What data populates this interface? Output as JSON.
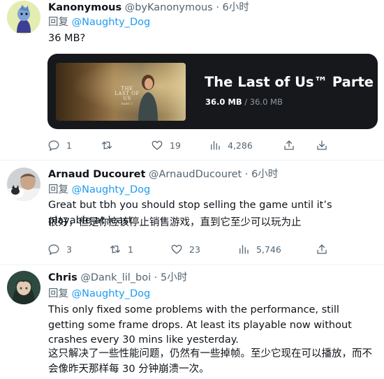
{
  "tweets": [
    {
      "display_name": "Kanonymous",
      "handle": "@byKanonymous",
      "separator": "·",
      "time": "6小时",
      "reply_prefix": "回复",
      "reply_to": "@Naughty_Dog",
      "text": "36 MB?",
      "card": {
        "title": "The Last of Us™ Parte I",
        "current_size": "36.0 MB",
        "size_separator": "/",
        "total_size": "36.0 MB",
        "cover_logo_line1": "THE LAST OF US",
        "cover_logo_line2": "PART I"
      },
      "actions": {
        "replies": "1",
        "retweets": "",
        "likes": "19",
        "views": "4,286"
      }
    },
    {
      "display_name": "Arnaud Ducouret",
      "handle": "@ArnaudDucouret",
      "separator": "·",
      "time": "6小时",
      "reply_prefix": "回复",
      "reply_to": "@Naughty_Dog",
      "text": "Great but tbh you should stop selling the game until it’s playable at least",
      "translation": "很好，但是你应该停止销售游戏，直到它至少可以玩为止",
      "actions": {
        "replies": "3",
        "retweets": "1",
        "likes": "23",
        "views": "5,746"
      }
    },
    {
      "display_name": "Chris",
      "handle": "@Dank_lil_boi",
      "separator": "·",
      "time": "5小时",
      "reply_prefix": "回复",
      "reply_to": "@Naughty_Dog",
      "text": "This only fixed some problems with the performance, still getting some frame drops. At least its playable now without crashes every 30 mins like yesterday.",
      "translation": "这只解决了一些性能问题，仍然有一些掉帧。至少它现在可以播放，而不会像昨天那样每 30 分钟崩溃一次。"
    }
  ],
  "icons": {
    "reply": "speech-bubble-icon",
    "retweet": "retweet-arrows-icon",
    "like": "heart-icon",
    "views": "bar-chart-icon",
    "share": "share-upload-icon",
    "bookmark": "download-icon"
  },
  "colors": {
    "link": "#1d9bf0",
    "muted": "#536471",
    "card_bg": "#16181c"
  }
}
